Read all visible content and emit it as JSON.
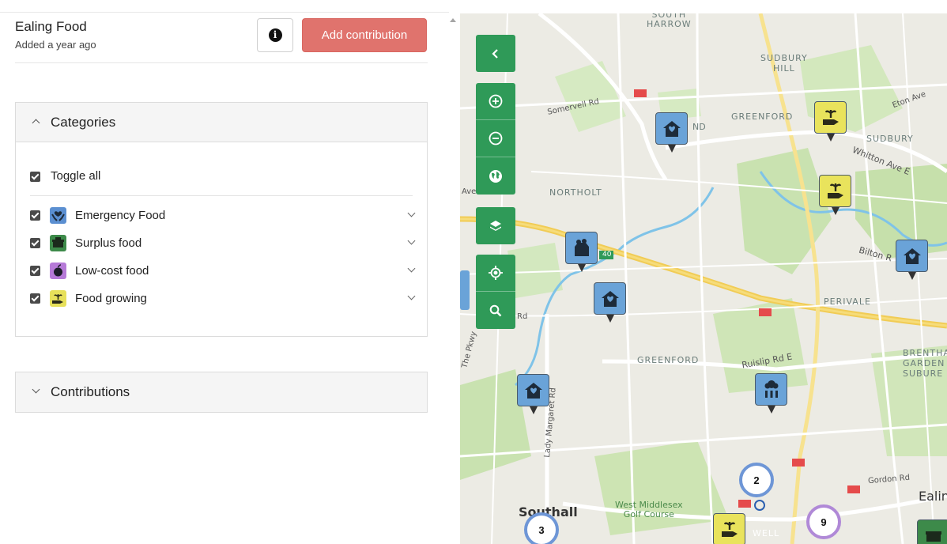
{
  "project": {
    "title": "Ealing Food",
    "subtitle": "Added a year ago",
    "add_contribution_label": "Add contribution"
  },
  "categories_panel": {
    "title": "Categories",
    "toggle_all_label": "Toggle all",
    "items": [
      {
        "label": "Emergency Food",
        "checked": true,
        "icon": "hands-heart-icon",
        "icon_color": "#5b8fd1"
      },
      {
        "label": "Surplus food",
        "checked": true,
        "icon": "food-container-icon",
        "icon_color": "#3d8a4a"
      },
      {
        "label": "Low-cost food",
        "checked": true,
        "icon": "apple-icon",
        "icon_color": "#b67ad8"
      },
      {
        "label": "Food growing",
        "checked": true,
        "icon": "plant-hand-icon",
        "icon_color": "#e7e05a"
      }
    ]
  },
  "contributions_panel": {
    "title": "Contributions"
  },
  "map": {
    "place_labels": {
      "south_harrow": "SOUTH\nHARROW",
      "sudbury_hill": "SUDBURY\nHILL",
      "greenford_n": "GREENFORD",
      "sudbury": "SUDBURY",
      "northolt": "NORTHOLT",
      "perivale": "PERIVALE",
      "greenford": "GREENFORD",
      "brentham": "BRENTHA\nGARDEN\nSUBURE",
      "southall": "Southall",
      "golf": "West Middlesex\nGolf Course",
      "ealing": "Ealin",
      "well": "WELL"
    },
    "road_labels": {
      "somervell": "Somervell Rd",
      "eton": "Eton Ave",
      "whitton": "Whitton Ave E",
      "bilton": "Bilton R",
      "ruislip": "Ruislip Rd E",
      "lady": "Lady Margaret Rd",
      "pkwy": "The Pkwy",
      "gordon": "Gordon Rd",
      "ave": "Ave",
      "rd": "Rd",
      "a40": "40",
      "nd": "ND"
    },
    "clusters": [
      "2",
      "3",
      "9"
    ],
    "controls": [
      "collapse-icon",
      "zoom-in-icon",
      "zoom-out-icon",
      "globe-icon",
      "layers-icon",
      "locate-icon",
      "search-icon"
    ],
    "colors": {
      "control_green": "#2f9a58",
      "marker_blue": "#6aa3d8",
      "marker_yellow": "#e9e35c",
      "add_button": "#e0736d"
    }
  }
}
